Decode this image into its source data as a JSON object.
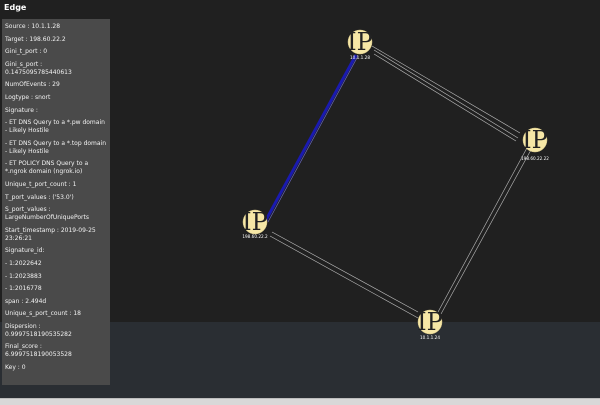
{
  "header": {
    "title": "Edge"
  },
  "panel": {
    "rows": [
      "Source : 10.1.1.28",
      "Target : 198.60.22.2",
      "Gini_t_port : 0",
      "Gini_s_port : 0.1475095785440613",
      "NumOfEvents : 29",
      "Logtype : snort",
      "Signature :",
      "- ET DNS Query to a *.pw domain - Likely Hostile",
      "- ET DNS Query to a *.top domain - Likely Hostile",
      "- ET POLICY DNS Query to a *.ngrok domain (ngrok.io)",
      "Unique_t_port_count : 1",
      "T_port_values : ('53.0')",
      "S_port_values : LargeNumberOfUniquePorts",
      "Start_timestamp : 2019-09-25 23:26:21",
      "Signature_id:",
      "- 1:2022642",
      "- 1:2023883",
      "- 1:2016778",
      "span : 2.494d",
      "Unique_s_port_count : 18",
      "Dispersion : 0.9997518190535282",
      "Final_score : 6.9997518190053528",
      "Key : 0"
    ]
  },
  "graph": {
    "nodes": [
      {
        "id": "n1",
        "glyph": "IP",
        "label": "10.1.1.28"
      },
      {
        "id": "n2",
        "glyph": "IP",
        "label": "198.60.22.22"
      },
      {
        "id": "n3",
        "glyph": "IP",
        "label": "198.60.22.2"
      },
      {
        "id": "n4",
        "glyph": "IP",
        "label": "10.1.1.24"
      }
    ],
    "colors": {
      "node_fill": "#f6e7a6",
      "edge": "#bdbdbd",
      "selected_edge": "#1a1ab0"
    }
  }
}
